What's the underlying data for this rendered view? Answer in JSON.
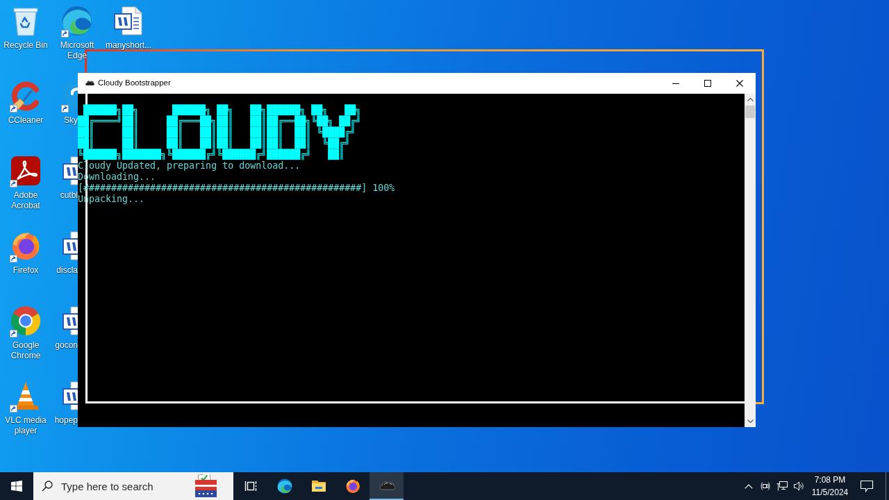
{
  "desktop": {
    "columns": [
      [
        {
          "label": "Recycle Bin",
          "kind": "recycle-bin",
          "shortcut": false
        },
        {
          "label": "CCleaner",
          "kind": "ccleaner",
          "shortcut": true
        },
        {
          "label": "Adobe Acrobat",
          "kind": "acrobat",
          "shortcut": true
        },
        {
          "label": "Firefox",
          "kind": "firefox",
          "shortcut": true
        },
        {
          "label": "Google Chrome",
          "kind": "chrome",
          "shortcut": true
        },
        {
          "label": "VLC media player",
          "kind": "vlc",
          "shortcut": true
        }
      ],
      [
        {
          "label": "Microsoft Edge",
          "kind": "edge",
          "shortcut": true
        },
        {
          "label": "Sky",
          "kind": "skype",
          "shortcut": true
        },
        {
          "label": "cutbl",
          "kind": "word",
          "shortcut": false
        },
        {
          "label": "discla",
          "kind": "word",
          "shortcut": false
        },
        {
          "label": "gocon",
          "kind": "word",
          "shortcut": false
        },
        {
          "label": "hopep",
          "kind": "word",
          "shortcut": false
        }
      ],
      [
        {
          "label": "manyshort...",
          "kind": "word",
          "shortcut": false
        }
      ]
    ]
  },
  "window": {
    "title": "Cloudy Bootstrapper",
    "console": {
      "banner": [
        " ██████╗██╗      ██████╗ ██╗   ██╗██████╗ ██╗   ██╗",
        "██╔════╝██║     ██╔═══██╗██║   ██║██╔══██╗╚██╗ ██╔╝",
        "██║     ██║     ██║   ██║██║   ██║██║  ██║ ╚████╔╝",
        "██║     ██║     ██║   ██║██║   ██║██║  ██║  ╚██╔╝",
        "╚██████╗███████╗╚██████╔╝╚██████╔╝██████╔╝   ██║"
      ],
      "lines": [
        "Cloudy Updated, preparing to download...",
        "Downloading...",
        "[##################################################] 100%",
        "Unpacking..."
      ]
    }
  },
  "taskbar": {
    "search": {
      "placeholder": "Type here to search"
    },
    "apps": [
      {
        "kind": "task-view",
        "selected": false
      },
      {
        "kind": "edge",
        "selected": false
      },
      {
        "kind": "explorer",
        "selected": false
      },
      {
        "kind": "firefox",
        "selected": false
      },
      {
        "kind": "cloudy",
        "selected": true
      }
    ],
    "clock": {
      "time": "7:08 PM",
      "date": "11/5/2024"
    }
  }
}
